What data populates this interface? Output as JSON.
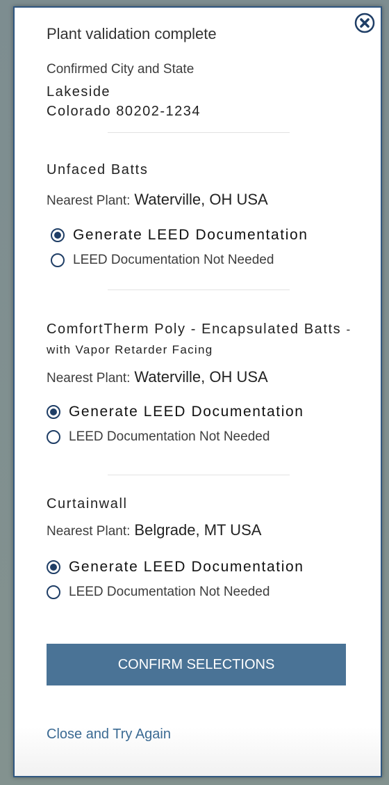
{
  "modal": {
    "title": "Plant validation complete",
    "close_icon": "close-circle-icon"
  },
  "location": {
    "label": "Confirmed City and State",
    "city": "Lakeside",
    "state_zip": "Colorado 80202-1234"
  },
  "products": [
    {
      "name": "Unfaced Batts",
      "name_suffix": "",
      "nearest_label": "Nearest Plant:",
      "nearest_value": "Waterville, OH USA",
      "options": [
        {
          "label": "Generate LEED Documentation",
          "checked": true
        },
        {
          "label": "LEED Documentation Not Needed",
          "checked": false
        }
      ]
    },
    {
      "name": "ComfortTherm Poly - Encapsulated Batts",
      "name_suffix": "- with Vapor Retarder Facing",
      "nearest_label": "Nearest Plant:",
      "nearest_value": "Waterville, OH USA",
      "options": [
        {
          "label": "Generate LEED Documentation",
          "checked": true
        },
        {
          "label": "LEED Documentation Not Needed",
          "checked": false
        }
      ]
    },
    {
      "name": "Curtainwall",
      "name_suffix": "",
      "nearest_label": "Nearest Plant:",
      "nearest_value": "Belgrade, MT USA",
      "options": [
        {
          "label": "Generate LEED Documentation",
          "checked": true
        },
        {
          "label": "LEED Documentation Not Needed",
          "checked": false
        }
      ]
    }
  ],
  "actions": {
    "confirm_label": "CONFIRM SELECTIONS",
    "retry_label": "Close and Try Again"
  },
  "colors": {
    "accent": "#4a7396",
    "border": "#2f5680",
    "link": "#3b6a93",
    "radio": "#1f3e66"
  }
}
